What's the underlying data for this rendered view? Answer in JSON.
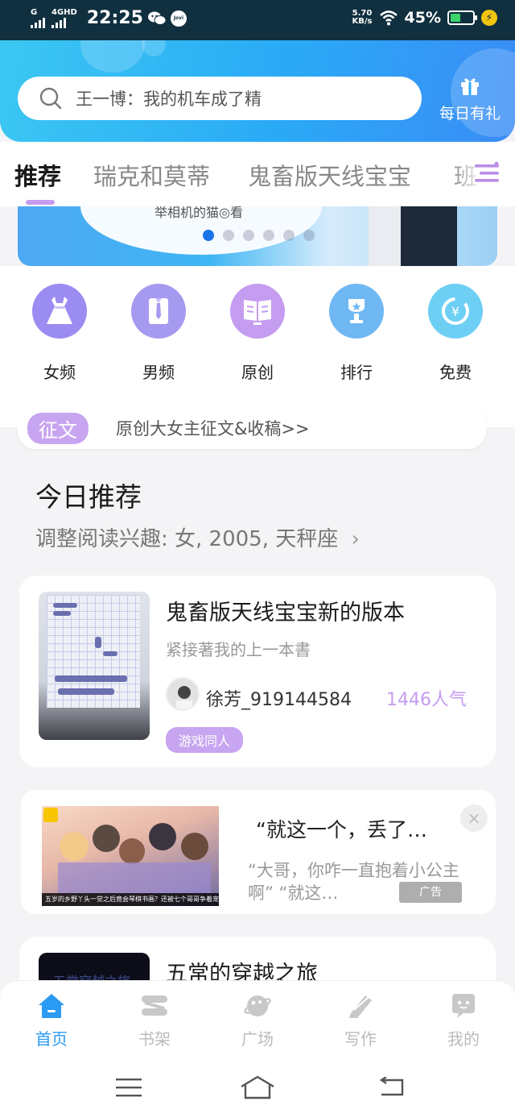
{
  "status_bar": {
    "signal_1": "G",
    "signal_2": "4GHD",
    "time": "22:25",
    "jovi": "Jovi",
    "speed_value": "5.70",
    "speed_unit": "KB/s",
    "battery_percent": "45%",
    "battery_level": 0.45
  },
  "header": {
    "search_placeholder": "王一博：我的机车成了精",
    "gift_label": "每日有礼"
  },
  "tabs": [
    {
      "label": "推荐",
      "active": true
    },
    {
      "label": "瑞克和莫蒂",
      "active": false
    },
    {
      "label": "鬼畜版天线宝宝",
      "active": false
    },
    {
      "label": "班",
      "active": false
    }
  ],
  "banner": {
    "caption_fragment": "举相机的猫◎看",
    "dot_count": 6,
    "active_dot": 0
  },
  "categories": [
    {
      "label": "女频",
      "icon": "dress-icon",
      "color": "#9b8cf2"
    },
    {
      "label": "男频",
      "icon": "shirt-icon",
      "color": "#a59af0"
    },
    {
      "label": "原创",
      "icon": "book-icon",
      "color": "#c49cf0"
    },
    {
      "label": "排行",
      "icon": "trophy-icon",
      "color": "#6fb8f4"
    },
    {
      "label": "免费",
      "icon": "coin-icon",
      "color": "#6ecff5"
    }
  ],
  "notice": {
    "tag": "征文",
    "text": "原创大女主征文&收稿>>"
  },
  "section": {
    "title": "今日推荐",
    "subtitle": "调整阅读兴趣: 女, 2005, 天秤座",
    "chevron": "›"
  },
  "book": {
    "title": "鬼畜版天线宝宝新的版本",
    "desc": "紧接著我的上一本書",
    "author": "徐芳_919144584",
    "popularity": "1446人气",
    "genre": "游戏同人"
  },
  "ad": {
    "title": "“就这一个，丢了…",
    "body": "“大哥，你咋一直抱着小公主啊” “就这…",
    "badge": "广告",
    "close": "×",
    "image_caption": "五岁的乡野丫头一觉之后竟会琴棋书画？还被七个哥哥争着宠？"
  },
  "book2": {
    "title": "五常的穿越之旅",
    "cover_text": "五常穿越之旅"
  },
  "bottom_nav": [
    {
      "label": "首页",
      "icon": "home-icon",
      "active": true
    },
    {
      "label": "书架",
      "icon": "bookshelf-icon",
      "active": false
    },
    {
      "label": "广场",
      "icon": "planet-icon",
      "active": false
    },
    {
      "label": "写作",
      "icon": "pen-icon",
      "active": false
    },
    {
      "label": "我的",
      "icon": "chat-icon",
      "active": false
    }
  ],
  "colors": {
    "accent_blue": "#2a9af2",
    "accent_purple": "#c59cf0",
    "header_gradient_start": "#3cc8f2",
    "header_gradient_end": "#3a8cf6"
  }
}
